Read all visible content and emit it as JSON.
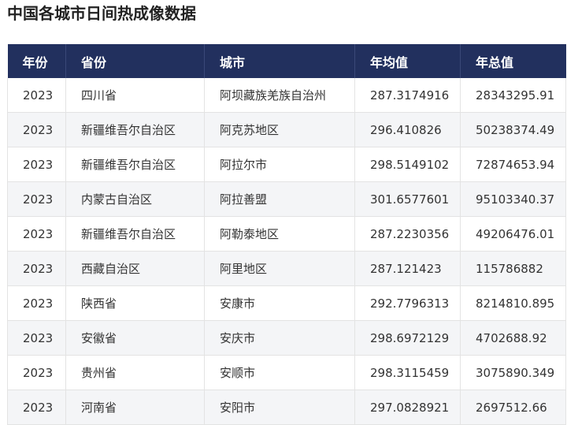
{
  "page": {
    "title": "中国各城市日间热成像数据"
  },
  "table": {
    "columns": [
      "年份",
      "省份",
      "城市",
      "年均值",
      "年总值"
    ],
    "rows": [
      [
        "2023",
        "四川省",
        "阿坝藏族羌族自治州",
        "287.3174916",
        "28343295.91"
      ],
      [
        "2023",
        "新疆维吾尔自治区",
        "阿克苏地区",
        "296.410826",
        "50238374.49"
      ],
      [
        "2023",
        "新疆维吾尔自治区",
        "阿拉尔市",
        "298.5149102",
        "72874653.94"
      ],
      [
        "2023",
        "内蒙古自治区",
        "阿拉善盟",
        "301.6577601",
        "95103340.37"
      ],
      [
        "2023",
        "新疆维吾尔自治区",
        "阿勒泰地区",
        "287.2230356",
        "49206476.01"
      ],
      [
        "2023",
        "西藏自治区",
        "阿里地区",
        "287.121423",
        "115786882"
      ],
      [
        "2023",
        "陕西省",
        "安康市",
        "292.7796313",
        "8214810.895"
      ],
      [
        "2023",
        "安徽省",
        "安庆市",
        "298.6972129",
        "4702688.92"
      ],
      [
        "2023",
        "贵州省",
        "安顺市",
        "298.3115459",
        "3075890.349"
      ],
      [
        "2023",
        "河南省",
        "安阳市",
        "297.0828921",
        "2697512.66"
      ]
    ]
  },
  "colors": {
    "header_bg": "#22305e",
    "header_text": "#ffffff",
    "stripe_bg": "#f4f5f7",
    "border": "#e3e3e3"
  }
}
